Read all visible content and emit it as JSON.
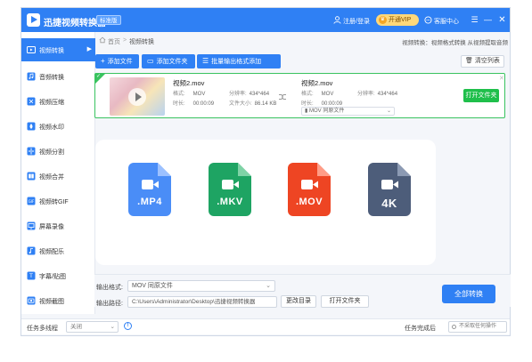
{
  "titlebar": {
    "app_name": "迅捷视频转换器",
    "edition": "标准版",
    "login": "注册/登录",
    "vip": "开通VIP",
    "service": "客服中心",
    "icons": {
      "user": "user-icon",
      "vip": "crown-icon",
      "service": "chat-bubble-icon",
      "menu": "menu-icon",
      "minimize": "minimize-icon",
      "close": "close-icon"
    }
  },
  "sidebar": {
    "items": [
      {
        "label": "视频转换",
        "icon": "video-convert-icon",
        "active": true
      },
      {
        "label": "音频转换",
        "icon": "audio-icon",
        "active": false
      },
      {
        "label": "视频压缩",
        "icon": "compress-icon",
        "active": false
      },
      {
        "label": "视频水印",
        "icon": "watermark-icon",
        "active": false
      },
      {
        "label": "视频分割",
        "icon": "split-icon",
        "active": false
      },
      {
        "label": "视频合并",
        "icon": "merge-icon",
        "active": false
      },
      {
        "label": "视频转GIF",
        "icon": "gif-icon",
        "active": false
      },
      {
        "label": "屏幕录像",
        "icon": "screen-record-icon",
        "active": false
      },
      {
        "label": "视频配乐",
        "icon": "music-icon",
        "active": false
      },
      {
        "label": "字幕/贴图",
        "icon": "subtitle-icon",
        "active": false
      },
      {
        "label": "视频截图",
        "icon": "screenshot-icon",
        "active": false
      }
    ]
  },
  "breadcrumb": {
    "home": "首页",
    "separator": ">",
    "current": "视频转换",
    "info": "视频转换：视频格式转换 从视频提取音频"
  },
  "toolbar": {
    "add_file": "添加文件",
    "add_folder": "添加文件夹",
    "batch_format": "批量输出格式添加",
    "clear_list": "清空列表"
  },
  "file": {
    "source": {
      "name": "视频2.mov",
      "format_label": "格式:",
      "format": "MOV",
      "resolution_label": "分辨率:",
      "resolution": "434*464",
      "duration_label": "时长:",
      "duration": "00:00:09",
      "size_label": "文件大小:",
      "size": "86.14 KB"
    },
    "target": {
      "name": "视频2.mov",
      "format_label": "格式:",
      "format": "MOV",
      "resolution_label": "分辨率:",
      "resolution": "434*464",
      "duration_label": "时长:",
      "duration": "00:00:09",
      "format_select": "MOV 同原文件"
    },
    "open_folder": "打开文件夹"
  },
  "hero": {
    "formats": [
      {
        "label": ".MP4",
        "color": "#4a8df7",
        "fold": "#9cc1ff"
      },
      {
        "label": ".MKV",
        "color": "#1ea463",
        "fold": "#7fd3a6"
      },
      {
        "label": ".MOV",
        "color": "#ee4523",
        "fold": "#ff9c86"
      },
      {
        "label": "4K",
        "color": "#4d5d7a",
        "fold": "#8c9ab3"
      }
    ]
  },
  "output": {
    "format_label": "输出格式:",
    "format_value": "MOV 同原文件",
    "path_label": "输出路径:",
    "path_value": "C:\\Users\\Administrator\\Desktop\\迅捷视频转换器",
    "change_dir": "更改目录",
    "open_dir": "打开文件夹",
    "convert_all": "全部转换"
  },
  "status": {
    "multithread_label": "任务多线程",
    "multithread_value": "关闭",
    "after_done_label": "任务完成后",
    "after_done_value": "不采取任何操作"
  },
  "colors": {
    "accent": "#2f80f4",
    "success": "#1fbf4b"
  }
}
